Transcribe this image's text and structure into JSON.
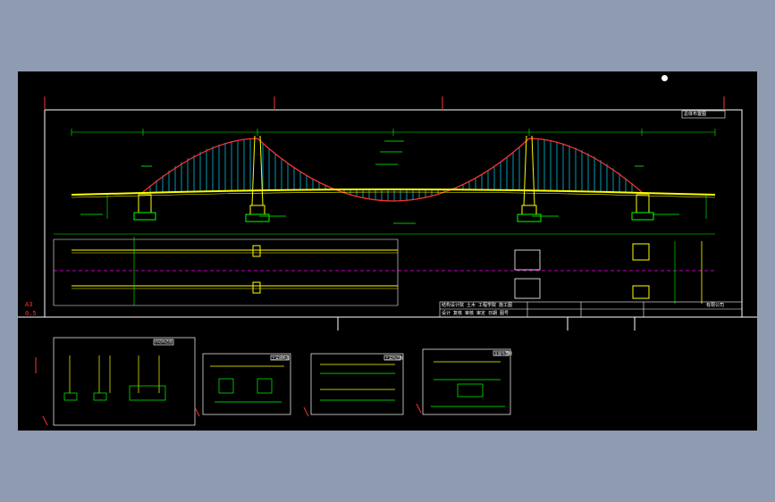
{
  "drawing": {
    "sheet_size_label": "A3",
    "scale_label": "0.5",
    "titleblock": {
      "row1": "结构设计院 土木 工程学院 施工图",
      "row2": "设计 复核 审核 审定 日期 图号",
      "company": "有限公司"
    },
    "main_title_box": "总体布置图",
    "detail_sheets": [
      {
        "title_box": "桥塔构造图"
      },
      {
        "title_box": "主梁横断面"
      },
      {
        "title_box": "主梁构造图"
      },
      {
        "title_box": "支座布置图"
      }
    ]
  },
  "colors": {
    "background_outer": "#8e9bb0",
    "model_space": "#000000",
    "cable": "#ff3333",
    "hanger": "#00d8ff",
    "deck": "#ffff00",
    "tower": "#ffff00",
    "dimension": "#00ff00",
    "centerline": "#ff00ff",
    "frame": "#ffffff"
  }
}
